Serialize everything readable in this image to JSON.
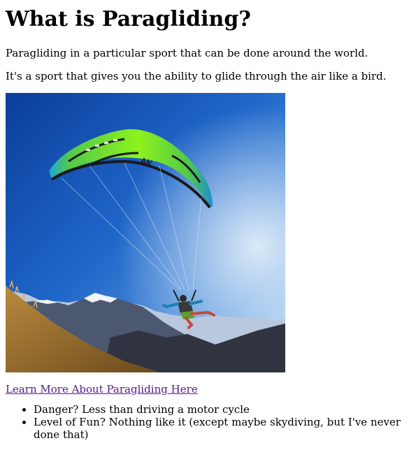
{
  "heading": "What is Paragliding?",
  "paragraphs": [
    "Paragliding in a particular sport that can be done around the world.",
    "It's a sport that gives you the ability to glide through the air like a bird."
  ],
  "image": {
    "alt": "Paraglider flying over mountains",
    "canopy_brand_mark": "AK"
  },
  "link": {
    "text": "Learn More About Paragliding Here",
    "color": "#551a8b"
  },
  "list": [
    "Danger? Less than driving a motor cycle",
    "Level of Fun? Nothing like it (except maybe skydiving, but I've never done that)"
  ]
}
